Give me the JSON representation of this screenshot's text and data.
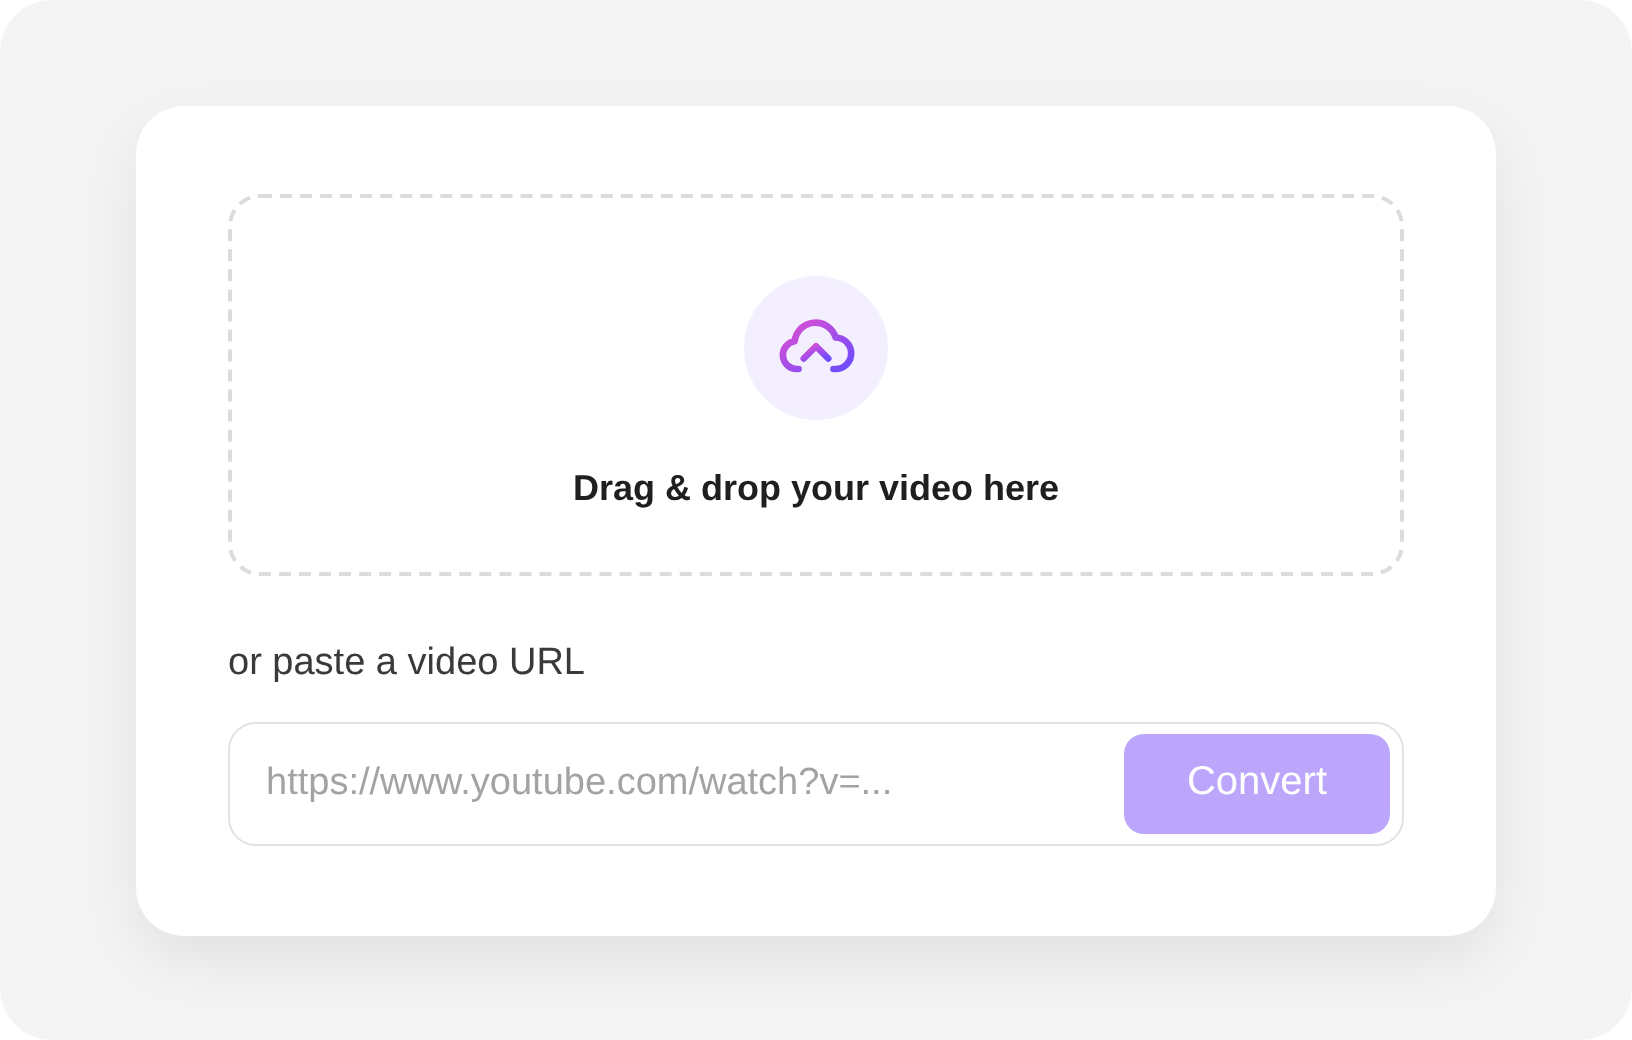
{
  "dropzone": {
    "label": "Drag & drop your video here"
  },
  "url_label": "or paste a video URL",
  "url_field": {
    "placeholder": "https://www.youtube.com/watch?v=..."
  },
  "convert_button": {
    "label": "Convert",
    "disabled": true
  }
}
